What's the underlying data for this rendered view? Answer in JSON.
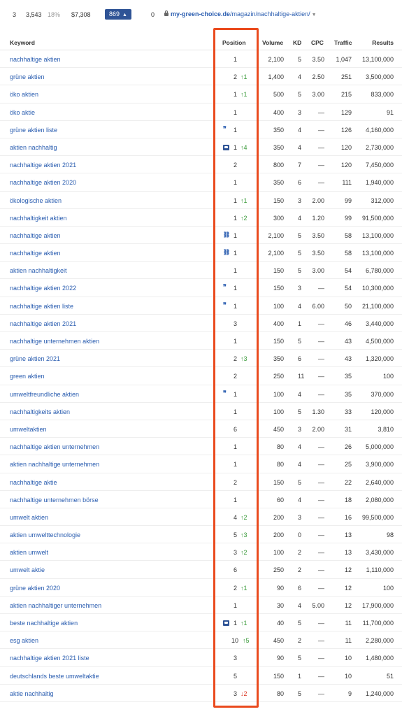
{
  "top_row": {
    "rank": "3",
    "volume": "3,543",
    "percent": "18%",
    "price": "$7,308",
    "badge": "869",
    "badge_arrow": "▲",
    "zero": "0",
    "url_domain": "my-green-choice.de",
    "url_path": "/magazin/nachhaltige-aktien/",
    "url_caret": "▼"
  },
  "table": {
    "headers": {
      "keyword": "Keyword",
      "position": "Position",
      "volume": "Volume",
      "kd": "KD",
      "cpc": "CPC",
      "traffic": "Traffic",
      "results": "Results"
    },
    "rows": [
      {
        "keyword": "nachhaltige aktien",
        "feature": "",
        "position": "1",
        "change": "",
        "dir": "",
        "volume": "2,100",
        "kd": "5",
        "cpc": "3.50",
        "traffic": "1,047",
        "results": "13,100,000"
      },
      {
        "keyword": "grüne aktien",
        "feature": "",
        "position": "2",
        "change": "↑1",
        "dir": "up",
        "volume": "1,400",
        "kd": "4",
        "cpc": "2.50",
        "traffic": "251",
        "results": "3,500,000"
      },
      {
        "keyword": "öko aktien",
        "feature": "",
        "position": "1",
        "change": "↑1",
        "dir": "up",
        "volume": "500",
        "kd": "5",
        "cpc": "3.00",
        "traffic": "215",
        "results": "833,000"
      },
      {
        "keyword": "öko aktie",
        "feature": "",
        "position": "1",
        "change": "",
        "dir": "",
        "volume": "400",
        "kd": "3",
        "cpc": "—",
        "traffic": "129",
        "results": "91"
      },
      {
        "keyword": "grüne aktien liste",
        "feature": "quote-icon",
        "position": "1",
        "change": "",
        "dir": "",
        "volume": "350",
        "kd": "4",
        "cpc": "—",
        "traffic": "126",
        "results": "4,160,000"
      },
      {
        "keyword": "aktien nachhaltig",
        "feature": "image-icon",
        "position": "1",
        "change": "↑4",
        "dir": "up",
        "volume": "350",
        "kd": "4",
        "cpc": "—",
        "traffic": "120",
        "results": "2,730,000"
      },
      {
        "keyword": "nachhaltige aktien 2021",
        "feature": "",
        "position": "2",
        "change": "",
        "dir": "",
        "volume": "800",
        "kd": "7",
        "cpc": "—",
        "traffic": "120",
        "results": "7,450,000"
      },
      {
        "keyword": "nachhaltige aktien 2020",
        "feature": "",
        "position": "1",
        "change": "",
        "dir": "",
        "volume": "350",
        "kd": "6",
        "cpc": "—",
        "traffic": "111",
        "results": "1,940,000"
      },
      {
        "keyword": "ökologische aktien",
        "feature": "",
        "position": "1",
        "change": "↑1",
        "dir": "up",
        "volume": "150",
        "kd": "3",
        "cpc": "2.00",
        "traffic": "99",
        "results": "312,000"
      },
      {
        "keyword": "nachhaltigkeit aktien",
        "feature": "",
        "position": "1",
        "change": "↑2",
        "dir": "up",
        "volume": "300",
        "kd": "4",
        "cpc": "1.20",
        "traffic": "99",
        "results": "91,500,000"
      },
      {
        "keyword": "nachhaltige aktien",
        "feature": "link-icon",
        "position": "1",
        "change": "",
        "dir": "",
        "volume": "2,100",
        "kd": "5",
        "cpc": "3.50",
        "traffic": "58",
        "results": "13,100,000"
      },
      {
        "keyword": "nachhaltige aktien",
        "feature": "link-icon",
        "position": "1",
        "change": "",
        "dir": "",
        "volume": "2,100",
        "kd": "5",
        "cpc": "3.50",
        "traffic": "58",
        "results": "13,100,000"
      },
      {
        "keyword": "aktien nachhaltigkeit",
        "feature": "",
        "position": "1",
        "change": "",
        "dir": "",
        "volume": "150",
        "kd": "5",
        "cpc": "3.00",
        "traffic": "54",
        "results": "6,780,000"
      },
      {
        "keyword": "nachhaltige aktien 2022",
        "feature": "quote-icon",
        "position": "1",
        "change": "",
        "dir": "",
        "volume": "150",
        "kd": "3",
        "cpc": "—",
        "traffic": "54",
        "results": "10,300,000"
      },
      {
        "keyword": "nachhaltige aktien liste",
        "feature": "quote-icon",
        "position": "1",
        "change": "",
        "dir": "",
        "volume": "100",
        "kd": "4",
        "cpc": "6.00",
        "traffic": "50",
        "results": "21,100,000"
      },
      {
        "keyword": "nachhaltige aktien 2021",
        "feature": "",
        "position": "3",
        "change": "",
        "dir": "",
        "volume": "400",
        "kd": "1",
        "cpc": "—",
        "traffic": "46",
        "results": "3,440,000"
      },
      {
        "keyword": "nachhaltige unternehmen aktien",
        "feature": "",
        "position": "1",
        "change": "",
        "dir": "",
        "volume": "150",
        "kd": "5",
        "cpc": "—",
        "traffic": "43",
        "results": "4,500,000"
      },
      {
        "keyword": "grüne aktien 2021",
        "feature": "",
        "position": "2",
        "change": "↑3",
        "dir": "up",
        "volume": "350",
        "kd": "6",
        "cpc": "—",
        "traffic": "43",
        "results": "1,320,000"
      },
      {
        "keyword": "green aktien",
        "feature": "",
        "position": "2",
        "change": "",
        "dir": "",
        "volume": "250",
        "kd": "11",
        "cpc": "—",
        "traffic": "35",
        "results": "100"
      },
      {
        "keyword": "umweltfreundliche aktien",
        "feature": "quote-icon",
        "position": "1",
        "change": "",
        "dir": "",
        "volume": "100",
        "kd": "4",
        "cpc": "—",
        "traffic": "35",
        "results": "370,000"
      },
      {
        "keyword": "nachhaltigkeits aktien",
        "feature": "",
        "position": "1",
        "change": "",
        "dir": "",
        "volume": "100",
        "kd": "5",
        "cpc": "1.30",
        "traffic": "33",
        "results": "120,000"
      },
      {
        "keyword": "umweltaktien",
        "feature": "",
        "position": "6",
        "change": "",
        "dir": "",
        "volume": "450",
        "kd": "3",
        "cpc": "2.00",
        "traffic": "31",
        "results": "3,810"
      },
      {
        "keyword": "nachhaltige aktien unternehmen",
        "feature": "",
        "position": "1",
        "change": "",
        "dir": "",
        "volume": "80",
        "kd": "4",
        "cpc": "—",
        "traffic": "26",
        "results": "5,000,000"
      },
      {
        "keyword": "aktien nachhaltige unternehmen",
        "feature": "",
        "position": "1",
        "change": "",
        "dir": "",
        "volume": "80",
        "kd": "4",
        "cpc": "—",
        "traffic": "25",
        "results": "3,900,000"
      },
      {
        "keyword": "nachhaltige aktie",
        "feature": "",
        "position": "2",
        "change": "",
        "dir": "",
        "volume": "150",
        "kd": "5",
        "cpc": "—",
        "traffic": "22",
        "results": "2,640,000"
      },
      {
        "keyword": "nachhaltige unternehmen börse",
        "feature": "",
        "position": "1",
        "change": "",
        "dir": "",
        "volume": "60",
        "kd": "4",
        "cpc": "—",
        "traffic": "18",
        "results": "2,080,000"
      },
      {
        "keyword": "umwelt aktien",
        "feature": "",
        "position": "4",
        "change": "↑2",
        "dir": "up",
        "volume": "200",
        "kd": "3",
        "cpc": "—",
        "traffic": "16",
        "results": "99,500,000"
      },
      {
        "keyword": "aktien umwelttechnologie",
        "feature": "",
        "position": "5",
        "change": "↑3",
        "dir": "up",
        "volume": "200",
        "kd": "0",
        "cpc": "—",
        "traffic": "13",
        "results": "98"
      },
      {
        "keyword": "aktien umwelt",
        "feature": "",
        "position": "3",
        "change": "↑2",
        "dir": "up",
        "volume": "100",
        "kd": "2",
        "cpc": "—",
        "traffic": "13",
        "results": "3,430,000"
      },
      {
        "keyword": "umwelt aktie",
        "feature": "",
        "position": "6",
        "change": "",
        "dir": "",
        "volume": "250",
        "kd": "2",
        "cpc": "—",
        "traffic": "12",
        "results": "1,110,000"
      },
      {
        "keyword": "grüne aktien 2020",
        "feature": "",
        "position": "2",
        "change": "↑1",
        "dir": "up",
        "volume": "90",
        "kd": "6",
        "cpc": "—",
        "traffic": "12",
        "results": "100"
      },
      {
        "keyword": "aktien nachhaltiger unternehmen",
        "feature": "",
        "position": "1",
        "change": "",
        "dir": "",
        "volume": "30",
        "kd": "4",
        "cpc": "5.00",
        "traffic": "12",
        "results": "17,900,000"
      },
      {
        "keyword": "beste nachhaltige aktien",
        "feature": "image-icon",
        "position": "1",
        "change": "↑1",
        "dir": "up",
        "volume": "40",
        "kd": "5",
        "cpc": "—",
        "traffic": "11",
        "results": "11,700,000"
      },
      {
        "keyword": "esg aktien",
        "feature": "",
        "position": "10",
        "change": "↑5",
        "dir": "up",
        "volume": "450",
        "kd": "2",
        "cpc": "—",
        "traffic": "11",
        "results": "2,280,000"
      },
      {
        "keyword": "nachhaltige aktien 2021 liste",
        "feature": "",
        "position": "3",
        "change": "",
        "dir": "",
        "volume": "90",
        "kd": "5",
        "cpc": "—",
        "traffic": "10",
        "results": "1,480,000"
      },
      {
        "keyword": "deutschlands beste umweltaktie",
        "feature": "",
        "position": "5",
        "change": "",
        "dir": "",
        "volume": "150",
        "kd": "1",
        "cpc": "—",
        "traffic": "10",
        "results": "51"
      },
      {
        "keyword": "aktie nachhaltig",
        "feature": "",
        "position": "3",
        "change": "↓2",
        "dir": "down",
        "volume": "80",
        "kd": "5",
        "cpc": "—",
        "traffic": "9",
        "results": "1,240,000"
      }
    ]
  },
  "colors": {
    "link": "#2a5db0",
    "up": "#3a9a3a",
    "down": "#d9331f",
    "highlight": "#ea4b1e",
    "badge": "#2f5496"
  }
}
